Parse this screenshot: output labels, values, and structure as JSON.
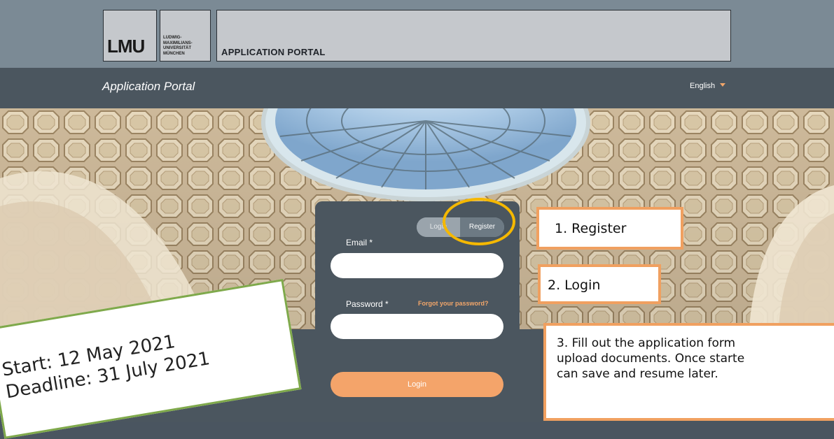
{
  "header": {
    "logo_text": "LMU",
    "university_name_lines": [
      "LUDWIG-",
      "MAXIMILIANS-",
      "UNIVERSITÄT",
      "MÜNCHEN"
    ],
    "portal_title": "APPLICATION PORTAL"
  },
  "nav": {
    "title": "Application Portal",
    "language": "English"
  },
  "login_card": {
    "tab_login": "Login",
    "tab_register": "Register",
    "email_label": "Email *",
    "password_label": "Password *",
    "forgot_password": "Forgot your password?",
    "login_button": "Login"
  },
  "callouts": {
    "step1": "1. Register",
    "step2": "2. Login",
    "step3_lines": [
      "3. Fill out the application form",
      "upload documents. Once starte",
      "can save and resume later."
    ]
  },
  "note": {
    "line1": "Start: 12 May 2021",
    "line2": "Deadline: 31 July 2021"
  },
  "colors": {
    "accent": "#f4a46a",
    "nav_bg": "#4b565f",
    "highlight": "#f5b800",
    "callout_border": "#f0a060",
    "note_border": "#7fa94b"
  }
}
